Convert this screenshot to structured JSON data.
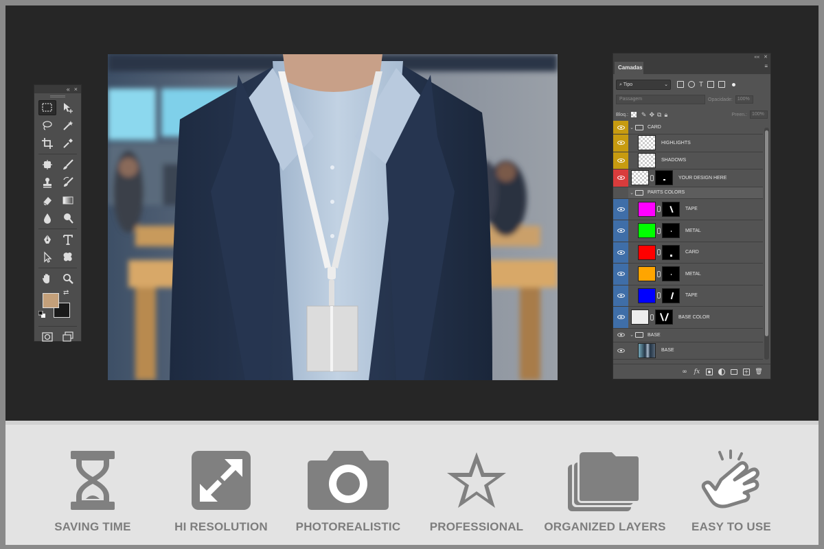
{
  "toolbar": {
    "header_controls": [
      "«",
      "×"
    ],
    "colors": {
      "foreground": "#c4a07a",
      "background": "#1a1a1a"
    },
    "tools": [
      [
        "marquee-icon",
        "move-icon"
      ],
      [
        "lasso-icon",
        "magic-wand-icon"
      ],
      [
        "crop-icon",
        "eyedropper-icon"
      ],
      [
        "healing-brush-icon",
        "brush-icon"
      ],
      [
        "clone-stamp-icon",
        "history-brush-icon"
      ],
      [
        "eraser-icon",
        "gradient-icon"
      ],
      [
        "blur-icon",
        "dodge-icon"
      ],
      [
        "pen-icon",
        "type-icon"
      ],
      [
        "path-selection-icon",
        "custom-shape-icon"
      ],
      [
        "hand-icon",
        "zoom-icon"
      ]
    ]
  },
  "layers_panel": {
    "tab_label": "Camadas",
    "kind_filter": "Tipo",
    "blend_mode": "Passagem",
    "opacity_label": "Opacidade:",
    "opacity_value": "100%",
    "lock_label": "Bloq.:",
    "fill_label": "Preen.:",
    "fill_value": "100%",
    "layers": [
      {
        "name": "CARD",
        "kind": "group",
        "eye": "yellow",
        "expanded": true
      },
      {
        "name": "HIGHLIGHTS",
        "kind": "layer",
        "eye": "yellow",
        "thumb": "checker",
        "indent": 1
      },
      {
        "name": "SHADOWS",
        "kind": "layer",
        "eye": "yellow",
        "thumb": "checker",
        "indent": 1
      },
      {
        "name": "YOUR DESIGN HERE",
        "kind": "smart",
        "eye": "red",
        "thumb": "checker"
      },
      {
        "name": "PARTS COLORS",
        "kind": "group",
        "eye": "none",
        "expanded": true
      },
      {
        "name": "TAPE",
        "kind": "fill",
        "eye": "blue",
        "color": "#ff00ff"
      },
      {
        "name": "METAL",
        "kind": "fill",
        "eye": "blue",
        "color": "#00ff00"
      },
      {
        "name": "CARD",
        "kind": "fill",
        "eye": "blue",
        "color": "#ff0000"
      },
      {
        "name": "METAL",
        "kind": "fill",
        "eye": "blue",
        "color": "#ffa500"
      },
      {
        "name": "TAPE",
        "kind": "fill",
        "eye": "blue",
        "color": "#0000ff"
      },
      {
        "name": "BASE COLOR",
        "kind": "fill",
        "eye": "blue",
        "color": "#eeeeee"
      },
      {
        "name": "BASE",
        "kind": "group",
        "eye": "none",
        "expanded": true
      },
      {
        "name": "BASE",
        "kind": "photo",
        "eye": "none",
        "indent": 1
      }
    ],
    "footer_icons": [
      "link-layers-icon",
      "fx-icon",
      "add-mask-icon",
      "adjustment-layer-icon",
      "new-group-icon",
      "new-layer-icon",
      "delete-layer-icon"
    ]
  },
  "features": [
    {
      "label": "SAVING TIME",
      "icon": "hourglass-icon"
    },
    {
      "label": "HI RESOLUTION",
      "icon": "expand-arrows-icon"
    },
    {
      "label": "PHOTOREALISTIC",
      "icon": "camera-icon"
    },
    {
      "label": "PROFESSIONAL",
      "icon": "star-icon"
    },
    {
      "label": "ORGANIZED LAYERS",
      "icon": "folders-icon"
    },
    {
      "label": "EASY TO USE",
      "icon": "tap-hand-icon"
    }
  ],
  "theme": {
    "workspace": "#262626",
    "panel": "#535353",
    "feature_text": "#7d7d7d",
    "feature_icon": "#808080"
  }
}
